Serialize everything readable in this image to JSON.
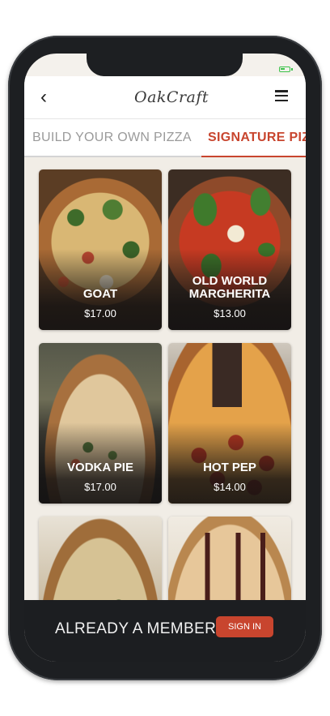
{
  "header": {
    "logo_text": "OakCraft",
    "back_icon": "chevron-left-icon",
    "menu_icon": "hamburger-menu-icon"
  },
  "tabs": [
    {
      "label": "BUILD YOUR OWN PIZZA",
      "active": false
    },
    {
      "label": "SIGNATURE PIZZAS",
      "active": true
    }
  ],
  "menu_items": [
    {
      "name": "GOAT",
      "price": "$17.00"
    },
    {
      "name": "OLD WORLD\nMARGHERITA",
      "price": "$13.00"
    },
    {
      "name": "VODKA PIE",
      "price": "$17.00"
    },
    {
      "name": "HOT PEP",
      "price": "$14.00"
    },
    {
      "name": "",
      "price": ""
    },
    {
      "name": "",
      "price": ""
    }
  ],
  "footer": {
    "member_prompt": "ALREADY A MEMBER?",
    "signin_label": "SIGN IN"
  },
  "colors": {
    "accent": "#c8452e",
    "footer_bg": "#1c1e21",
    "battery": "#3cc24a"
  }
}
